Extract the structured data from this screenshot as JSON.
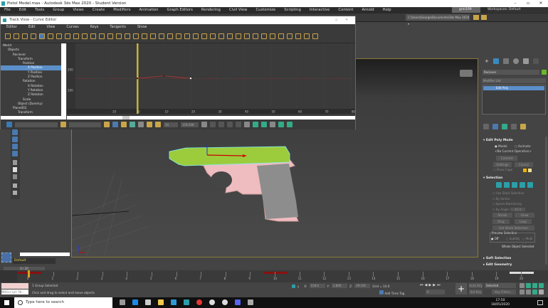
{
  "window": {
    "title": "Pistol Model.max - Autodesk 3ds Max 2020 - Student Version"
  },
  "menu": [
    "File",
    "Edit",
    "Tools",
    "Group",
    "Views",
    "Create",
    "Modifiers",
    "Animation",
    "Graph Editors",
    "Rendering",
    "Civil View",
    "Customize",
    "Scripting",
    "Interactive",
    "Content",
    "Arnold",
    "Help"
  ],
  "toolbar": {
    "user": "grm109",
    "workspace_label": "Workspaces:",
    "workspace": "Default",
    "path": "C:\\Users\\George\\Documents\\3ds Max 2020"
  },
  "curve_editor": {
    "title": "Track View - Curve Editor",
    "menu": [
      "Editor",
      "Edit",
      "View",
      "Curves",
      "Keys",
      "Tangents",
      "Show"
    ],
    "tree": [
      {
        "label": "World",
        "depth": 0
      },
      {
        "label": "Objects",
        "depth": 1
      },
      {
        "label": "Reciever",
        "depth": 2
      },
      {
        "label": "Transform",
        "depth": 3
      },
      {
        "label": "Position",
        "depth": 4
      },
      {
        "label": "X Position",
        "depth": 5,
        "selected": true
      },
      {
        "label": "Y Position",
        "depth": 5
      },
      {
        "label": "Z Position",
        "depth": 5
      },
      {
        "label": "Rotation",
        "depth": 4
      },
      {
        "label": "X Rotation",
        "depth": 5
      },
      {
        "label": "Y Rotation",
        "depth": 5
      },
      {
        "label": "Z Rotation",
        "depth": 5
      },
      {
        "label": "Scale",
        "depth": 4
      },
      {
        "label": "Object (Dummy)",
        "depth": 3
      },
      {
        "label": "Plane002",
        "depth": 2
      },
      {
        "label": "Transform",
        "depth": 3
      }
    ],
    "y_ticks": [
      "200",
      "100",
      "0"
    ],
    "x_ticks": [
      "-10",
      "0",
      "10",
      "20",
      "30",
      "40",
      "50",
      "60",
      "70",
      "80",
      "90"
    ],
    "keys": [
      {
        "frame": 0,
        "value": 158
      },
      {
        "frame": 10,
        "value": 170
      },
      {
        "frame": 20,
        "value": 158
      }
    ],
    "frame_field": "20",
    "value_field": "158.008"
  },
  "command_panel": {
    "object_name": "Reciever",
    "object_color": "#6ab82a",
    "modifier_list": "Modifier List",
    "stack": [
      "Edit Poly"
    ],
    "edit_poly_mode": {
      "title": "Edit Poly Mode",
      "model": "Model",
      "animate": "Animate",
      "operation": "<No Current Operation>",
      "commit": "Commit",
      "settings": "Settings",
      "cancel": "Cancel",
      "show_cage": "Show Cage"
    },
    "selection": {
      "title": "Selection",
      "use_stack": "Use Stack Selection",
      "by_vertex": "By Vertex",
      "ignore_backfacing": "Ignore Backfacing",
      "by_angle": "By Angle:",
      "angle": "45.0",
      "shrink": "Shrink",
      "grow": "Grow",
      "ring": "Ring",
      "loop": "Loop",
      "get_stack": "Get Stack Selection",
      "preview": "Preview Selection",
      "off": "Off",
      "subobj": "SubObj",
      "multi": "Multi",
      "whole": "Whole Object Selected"
    },
    "soft_selection": "Soft Selection",
    "edit_geometry": "Edit Geometry"
  },
  "left_panel": {
    "layer": "Default"
  },
  "timeline": {
    "slider": "0 / 20",
    "labels": [
      "0",
      "1",
      "2",
      "3",
      "4",
      "5",
      "6",
      "7",
      "8",
      "9",
      "10",
      "11",
      "12",
      "13",
      "14",
      "15",
      "16",
      "17",
      "18",
      "19",
      "20"
    ],
    "key_frames": [
      0,
      10,
      20
    ]
  },
  "status": {
    "selection": "1 Group Selected",
    "prompt": "Click and drag to select and move objects",
    "maxscript": "MAXScript Mi:",
    "x_label": "X:",
    "x": "158.0",
    "y_label": "Y:",
    "y": "2.806",
    "z_label": "Z:",
    "z": "29.191",
    "grid": "Grid = 10.0",
    "add_time_tag": "Add Time Tag",
    "frame": "0",
    "auto_key": "Auto Key",
    "set_key": "Set Key",
    "selected": "Selected",
    "key_filters": "Key Filters..."
  },
  "taskbar": {
    "search": "Type here to search",
    "time": "17:50",
    "date": "18/05/2020"
  }
}
